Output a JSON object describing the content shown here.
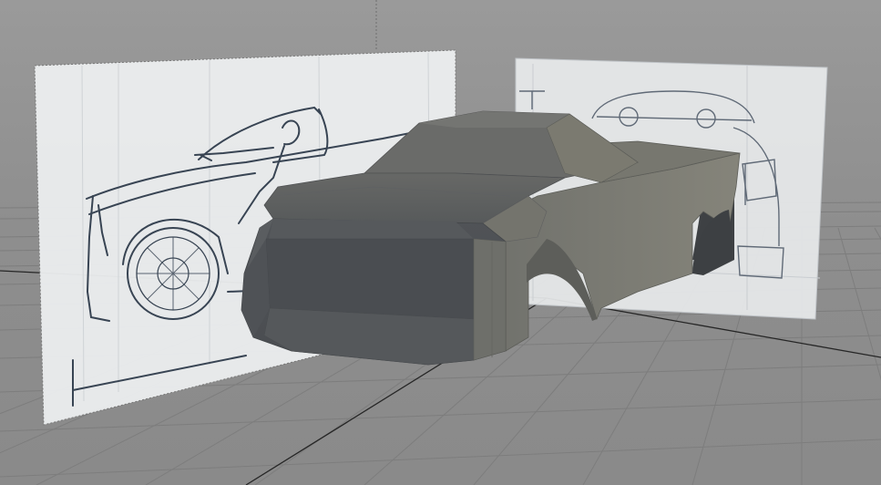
{
  "viewport": {
    "name": "3d-perspective-viewport",
    "model": "pickup-truck-blockout",
    "reference_images": [
      "side-view-sketch",
      "front-view-sketch"
    ]
  },
  "colors": {
    "background": "#8f8f8f",
    "grid_line": "#7c7c7c",
    "axis_line": "#2a2a2a",
    "truck_face_dark": "#4e5256",
    "truck_face_mid": "#6b6d6d",
    "truck_face_light": "#7f7d72",
    "sketch_paper": "#eef0f1",
    "sketch_ink": "#3b4654"
  }
}
